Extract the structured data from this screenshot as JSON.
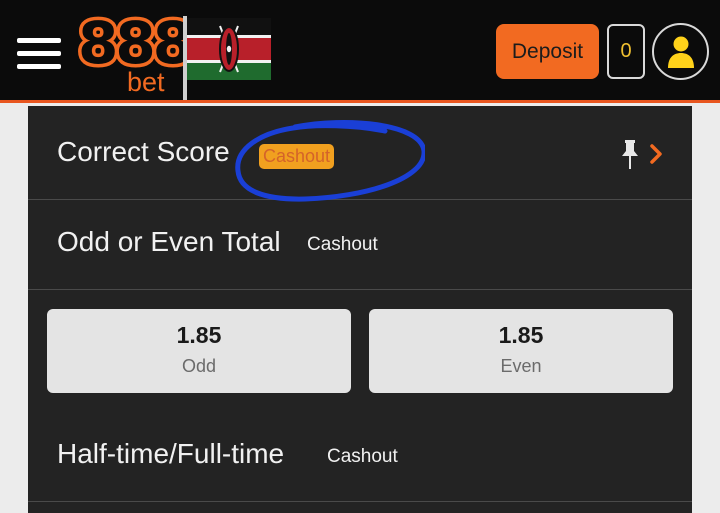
{
  "header": {
    "logo_number": "888",
    "logo_suffix": "bet",
    "flag_icon": "kenya-flag-icon",
    "deposit_label": "Deposit",
    "balance": "0",
    "avatar_icon": "user-icon"
  },
  "markets": [
    {
      "title": "Correct Score",
      "cashout": "Cashout"
    },
    {
      "title": "Odd or Even Total",
      "cashout": "Cashout"
    },
    {
      "title": "Half-time/Full-time",
      "cashout": "Cashout"
    }
  ],
  "odds": [
    {
      "value": "1.85",
      "label": "Odd"
    },
    {
      "value": "1.85",
      "label": "Even"
    }
  ],
  "colors": {
    "accent": "#f26a21",
    "header_bg": "#0b0b0b",
    "panel_bg": "#232323",
    "cashout_badge": "#f1a01f",
    "annotation": "#1a3fd6",
    "balance_text": "#f0c030"
  },
  "icons": [
    "menu-icon",
    "pin-icon",
    "chevron-right-icon"
  ]
}
